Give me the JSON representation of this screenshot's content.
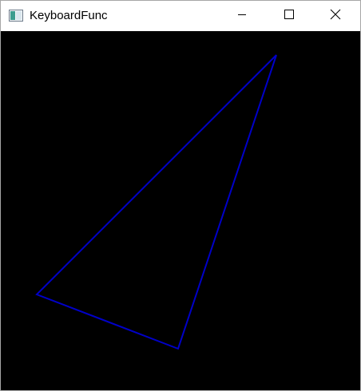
{
  "window": {
    "title": "KeyboardFunc",
    "icon": "app-window-icon",
    "controls": {
      "minimize": "minimize-icon",
      "maximize": "maximize-icon",
      "close": "close-icon"
    }
  },
  "canvas": {
    "background_color": "#000000",
    "shape": {
      "type": "triangle-outline",
      "stroke_color": "#0000c8"
    }
  }
}
